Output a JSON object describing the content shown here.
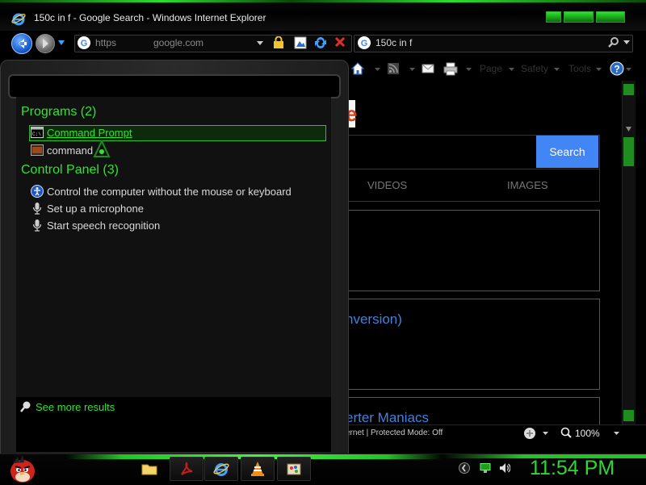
{
  "ie": {
    "title": "150c in f - Google Search - Windows Internet Explorer",
    "address_protocol": "https",
    "address_host": "google.com",
    "search_query": "150c in f",
    "command_items": [
      {
        "label": "Page"
      },
      {
        "label": "Safety"
      },
      {
        "label": "Tools"
      }
    ],
    "status_text": "ernet | Protected Mode: Off",
    "zoom": "100%"
  },
  "google": {
    "logo_fragment": "e",
    "search_button": "Search",
    "tab_videos": "VIDEOS",
    "tab_images": "IMAGES",
    "result_1": "nversion)",
    "result_2": "erter Maniacs"
  },
  "start_menu": {
    "programs_header": "Programs (2)",
    "programs": [
      {
        "label": "Command Prompt",
        "icon": "cmd-icon",
        "selected": true
      },
      {
        "label": "command",
        "icon": "command-icon"
      }
    ],
    "control_header": "Control Panel (3)",
    "control_items": [
      {
        "label": "Control the computer without the mouse or keyboard",
        "icon": "ease-of-access-icon"
      },
      {
        "label": "Set up a microphone",
        "icon": "microphone-icon"
      },
      {
        "label": "Start speech recognition",
        "icon": "microphone-icon"
      }
    ],
    "see_more": "See more results"
  },
  "taskbar": {
    "clock": "11:54 PM",
    "accent_color": "#2fd82f"
  },
  "colors": {
    "accent_green": "#31e331",
    "search_blue": "#4285f4",
    "link_blue": "#3f82e0"
  }
}
